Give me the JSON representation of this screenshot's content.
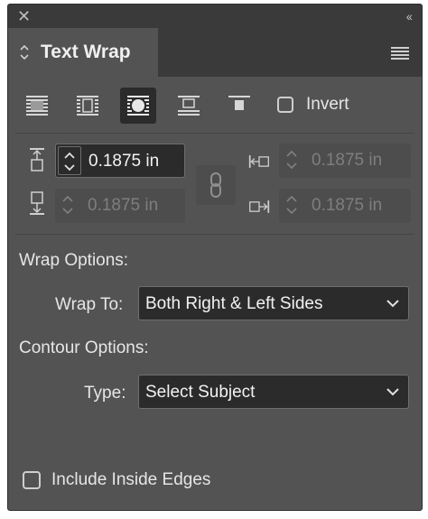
{
  "panel": {
    "tab_title": "Text Wrap"
  },
  "wrap_modes": [
    {
      "name": "no-text-wrap",
      "active": false
    },
    {
      "name": "wrap-around-bounding-box",
      "active": false
    },
    {
      "name": "wrap-around-object-shape",
      "active": true
    },
    {
      "name": "jump-object",
      "active": false
    },
    {
      "name": "jump-to-next-column",
      "active": false
    }
  ],
  "invert": {
    "label": "Invert",
    "checked": false
  },
  "offsets": {
    "top": "0.1875 in",
    "bottom": "0.1875 in",
    "left": "0.1875 in",
    "right": "0.1875 in"
  },
  "wrap_options": {
    "heading": "Wrap Options:",
    "wrap_to_label": "Wrap To:",
    "wrap_to_value": "Both Right & Left Sides"
  },
  "contour_options": {
    "heading": "Contour Options:",
    "type_label": "Type:",
    "type_value": "Select Subject"
  },
  "include_inside_edges": {
    "label": "Include Inside Edges",
    "checked": false
  },
  "colors": {
    "panel_bg": "#535353",
    "header_bg": "#3a3a3a",
    "field_bg": "#2b2b2b",
    "text": "#e6e6e6",
    "disabled_text": "#7e7e7e"
  }
}
